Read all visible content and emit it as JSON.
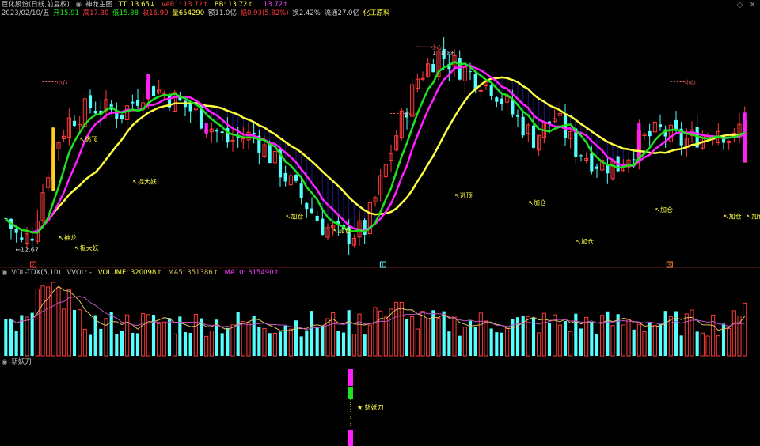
{
  "main": {
    "stock_title": "巨化股份(日线,前复权)",
    "indicator_name": "神龙主图",
    "tt": "TT: 13.65↓",
    "var1": "VAR1: 13.72↑",
    "bb": "BB: 13.72↑",
    "extra": ": 13.72↑",
    "date": "2023/02/10/五",
    "open": "开15.91",
    "high": "高17.30",
    "low": "低15.88",
    "close": "收16.90",
    "volume": "量654290",
    "amount": "额11.0亿",
    "change": "幅0.93(5.82%)",
    "turnover": "换2.42%",
    "float": "流通27.0亿",
    "industry": "化工原料"
  },
  "vol_panel": {
    "name": "VOL-TDX(5,10)",
    "vvol": "VVOL: -",
    "volume": "VOLUME: 320098↑",
    "ma5": "MA5: 351386↑",
    "ma10": "MA10: 315490↑"
  },
  "sub_panel": {
    "name": "斩妖刀"
  },
  "colors": {
    "up": "#ff3b3b",
    "down": "#54ffff",
    "ma_yellow": "#ffff40",
    "ma_green": "#20e020",
    "ma_magenta": "#ff20ff",
    "fill_blue": "#2020b0",
    "ma5": "#e0c060",
    "ma10": "#c050c0"
  },
  "chart_data": {
    "type": "candlestick",
    "symbol": "巨化股份",
    "period": "日线,前复权",
    "last_bar": {
      "date": "2023/02/10",
      "open": 15.91,
      "high": 17.3,
      "low": 15.88,
      "close": 16.9,
      "volume": 654290
    },
    "price_labels": [
      "12.67",
      "18.86"
    ],
    "signal_labels": [
      "逃顶",
      "捉大妖",
      "神龙",
      "捉大妖",
      "加仓",
      "加仓",
      "逃顶",
      "加仓",
      "加仓",
      "加仓",
      "加仓"
    ],
    "top_markers": [
      "小心",
      "小心",
      "小心",
      "小心"
    ],
    "date_markers": [
      "2",
      "1",
      "3"
    ],
    "sub_signal": "斩妖刀"
  }
}
